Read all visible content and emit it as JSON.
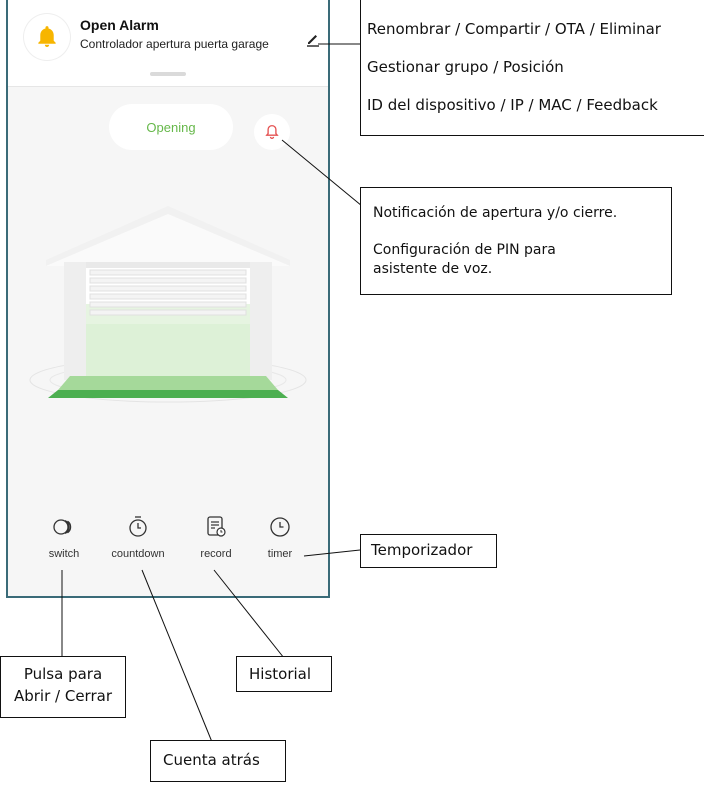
{
  "header": {
    "title": "Open Alarm",
    "subtitle": "Controlador apertura puerta garage",
    "app_icon": "bell-icon",
    "edit_icon": "pencil-icon"
  },
  "status": {
    "label": "Opening",
    "color": "#66b84a",
    "alarm_icon": "bell-outline-icon",
    "alarm_color": "#e55353"
  },
  "toolbar": {
    "items": [
      {
        "label": "switch",
        "icon": "switch-icon"
      },
      {
        "label": "countdown",
        "icon": "stopwatch-icon"
      },
      {
        "label": "record",
        "icon": "record-icon"
      },
      {
        "label": "timer",
        "icon": "clock-icon"
      }
    ]
  },
  "annotations": {
    "edit_menu": {
      "line1": "Renombrar / Compartir / OTA / Eliminar",
      "line2": "Gestionar grupo / Posición",
      "line3": "ID del dispositivo / IP / MAC / Feedback"
    },
    "notification": {
      "line1": "Notificación de apertura y/o cierre.",
      "line2": "Configuración de PIN para",
      "line3": "asistente de voz."
    },
    "timer": "Temporizador",
    "switch_line1": "Pulsa para",
    "switch_line2": "Abrir / Cerrar",
    "record": "Historial",
    "countdown": "Cuenta atrás"
  },
  "colors": {
    "accent_yellow": "#f7b500",
    "frame": "#3a6b78",
    "garage_green": "#4caf50"
  }
}
